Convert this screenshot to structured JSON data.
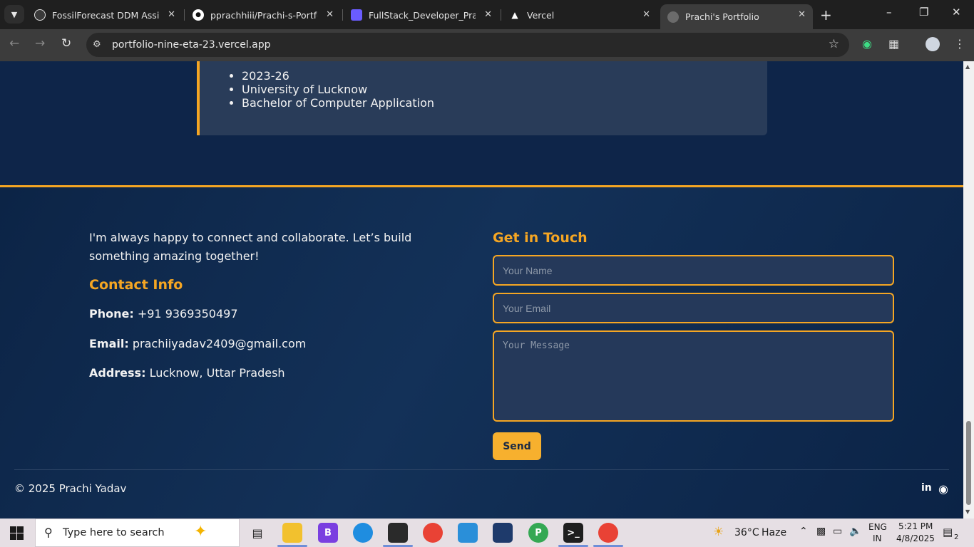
{
  "browser": {
    "tabs": [
      {
        "title": "FossilForecast DDM Assistant",
        "icon": "openai-icon",
        "active": false
      },
      {
        "title": "pprachhiii/Prachi-s-Portfolio",
        "icon": "github-icon",
        "active": false
      },
      {
        "title": "FullStack_Developer_Prachi_Y",
        "icon": "doc-icon",
        "active": false
      },
      {
        "title": "Vercel",
        "icon": "vercel-icon",
        "active": false
      },
      {
        "title": "Prachi's Portfolio",
        "icon": "globe-icon",
        "active": true
      }
    ],
    "url": "portfolio-nine-eta-23.vercel.app"
  },
  "education": {
    "items": [
      "2023-26",
      "University of Lucknow",
      "Bachelor of Computer Application"
    ]
  },
  "contact": {
    "intro": "I'm always happy to connect and collaborate. Let’s build something amazing together!",
    "info_heading": "Contact Info",
    "phone_label": "Phone:",
    "phone": "+91 9369350497",
    "email_label": "Email:",
    "email": "prachiiyadav2409@gmail.com",
    "address_label": "Address:",
    "address": "Lucknow, Uttar Pradesh",
    "form_heading": "Get in Touch",
    "name_placeholder": "Your Name",
    "email_placeholder": "Your Email",
    "message_placeholder": "Your Message",
    "send_label": "Send"
  },
  "footer": {
    "copyright": "© 2025 Prachi Yadav",
    "linkedin": "in"
  },
  "taskbar": {
    "search_placeholder": "Type here to search",
    "weather_temp": "36°C",
    "weather_desc": "Haze",
    "lang_line1": "ENG",
    "lang_line2": "IN",
    "time": "5:21 PM",
    "date": "4/8/2025",
    "notification_count": "2"
  },
  "colors": {
    "accent": "#f5a623",
    "page_bg": "#0d2447",
    "card_bg": "#293c59"
  }
}
